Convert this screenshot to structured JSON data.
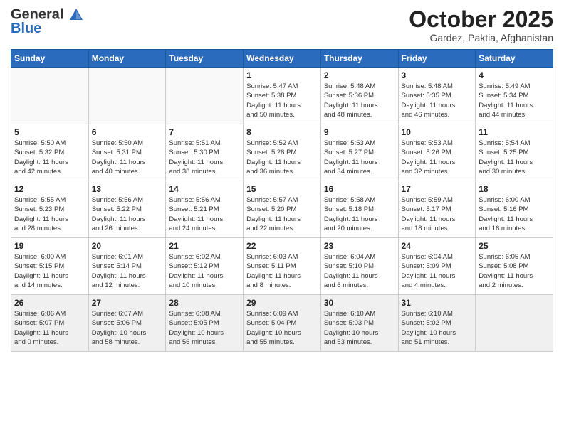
{
  "header": {
    "logo_general": "General",
    "logo_blue": "Blue",
    "month": "October 2025",
    "location": "Gardez, Paktia, Afghanistan"
  },
  "weekdays": [
    "Sunday",
    "Monday",
    "Tuesday",
    "Wednesday",
    "Thursday",
    "Friday",
    "Saturday"
  ],
  "weeks": [
    [
      {
        "day": "",
        "detail": ""
      },
      {
        "day": "",
        "detail": ""
      },
      {
        "day": "",
        "detail": ""
      },
      {
        "day": "1",
        "detail": "Sunrise: 5:47 AM\nSunset: 5:38 PM\nDaylight: 11 hours\nand 50 minutes."
      },
      {
        "day": "2",
        "detail": "Sunrise: 5:48 AM\nSunset: 5:36 PM\nDaylight: 11 hours\nand 48 minutes."
      },
      {
        "day": "3",
        "detail": "Sunrise: 5:48 AM\nSunset: 5:35 PM\nDaylight: 11 hours\nand 46 minutes."
      },
      {
        "day": "4",
        "detail": "Sunrise: 5:49 AM\nSunset: 5:34 PM\nDaylight: 11 hours\nand 44 minutes."
      }
    ],
    [
      {
        "day": "5",
        "detail": "Sunrise: 5:50 AM\nSunset: 5:32 PM\nDaylight: 11 hours\nand 42 minutes."
      },
      {
        "day": "6",
        "detail": "Sunrise: 5:50 AM\nSunset: 5:31 PM\nDaylight: 11 hours\nand 40 minutes."
      },
      {
        "day": "7",
        "detail": "Sunrise: 5:51 AM\nSunset: 5:30 PM\nDaylight: 11 hours\nand 38 minutes."
      },
      {
        "day": "8",
        "detail": "Sunrise: 5:52 AM\nSunset: 5:28 PM\nDaylight: 11 hours\nand 36 minutes."
      },
      {
        "day": "9",
        "detail": "Sunrise: 5:53 AM\nSunset: 5:27 PM\nDaylight: 11 hours\nand 34 minutes."
      },
      {
        "day": "10",
        "detail": "Sunrise: 5:53 AM\nSunset: 5:26 PM\nDaylight: 11 hours\nand 32 minutes."
      },
      {
        "day": "11",
        "detail": "Sunrise: 5:54 AM\nSunset: 5:25 PM\nDaylight: 11 hours\nand 30 minutes."
      }
    ],
    [
      {
        "day": "12",
        "detail": "Sunrise: 5:55 AM\nSunset: 5:23 PM\nDaylight: 11 hours\nand 28 minutes."
      },
      {
        "day": "13",
        "detail": "Sunrise: 5:56 AM\nSunset: 5:22 PM\nDaylight: 11 hours\nand 26 minutes."
      },
      {
        "day": "14",
        "detail": "Sunrise: 5:56 AM\nSunset: 5:21 PM\nDaylight: 11 hours\nand 24 minutes."
      },
      {
        "day": "15",
        "detail": "Sunrise: 5:57 AM\nSunset: 5:20 PM\nDaylight: 11 hours\nand 22 minutes."
      },
      {
        "day": "16",
        "detail": "Sunrise: 5:58 AM\nSunset: 5:18 PM\nDaylight: 11 hours\nand 20 minutes."
      },
      {
        "day": "17",
        "detail": "Sunrise: 5:59 AM\nSunset: 5:17 PM\nDaylight: 11 hours\nand 18 minutes."
      },
      {
        "day": "18",
        "detail": "Sunrise: 6:00 AM\nSunset: 5:16 PM\nDaylight: 11 hours\nand 16 minutes."
      }
    ],
    [
      {
        "day": "19",
        "detail": "Sunrise: 6:00 AM\nSunset: 5:15 PM\nDaylight: 11 hours\nand 14 minutes."
      },
      {
        "day": "20",
        "detail": "Sunrise: 6:01 AM\nSunset: 5:14 PM\nDaylight: 11 hours\nand 12 minutes."
      },
      {
        "day": "21",
        "detail": "Sunrise: 6:02 AM\nSunset: 5:12 PM\nDaylight: 11 hours\nand 10 minutes."
      },
      {
        "day": "22",
        "detail": "Sunrise: 6:03 AM\nSunset: 5:11 PM\nDaylight: 11 hours\nand 8 minutes."
      },
      {
        "day": "23",
        "detail": "Sunrise: 6:04 AM\nSunset: 5:10 PM\nDaylight: 11 hours\nand 6 minutes."
      },
      {
        "day": "24",
        "detail": "Sunrise: 6:04 AM\nSunset: 5:09 PM\nDaylight: 11 hours\nand 4 minutes."
      },
      {
        "day": "25",
        "detail": "Sunrise: 6:05 AM\nSunset: 5:08 PM\nDaylight: 11 hours\nand 2 minutes."
      }
    ],
    [
      {
        "day": "26",
        "detail": "Sunrise: 6:06 AM\nSunset: 5:07 PM\nDaylight: 11 hours\nand 0 minutes."
      },
      {
        "day": "27",
        "detail": "Sunrise: 6:07 AM\nSunset: 5:06 PM\nDaylight: 10 hours\nand 58 minutes."
      },
      {
        "day": "28",
        "detail": "Sunrise: 6:08 AM\nSunset: 5:05 PM\nDaylight: 10 hours\nand 56 minutes."
      },
      {
        "day": "29",
        "detail": "Sunrise: 6:09 AM\nSunset: 5:04 PM\nDaylight: 10 hours\nand 55 minutes."
      },
      {
        "day": "30",
        "detail": "Sunrise: 6:10 AM\nSunset: 5:03 PM\nDaylight: 10 hours\nand 53 minutes."
      },
      {
        "day": "31",
        "detail": "Sunrise: 6:10 AM\nSunset: 5:02 PM\nDaylight: 10 hours\nand 51 minutes."
      },
      {
        "day": "",
        "detail": ""
      }
    ]
  ]
}
